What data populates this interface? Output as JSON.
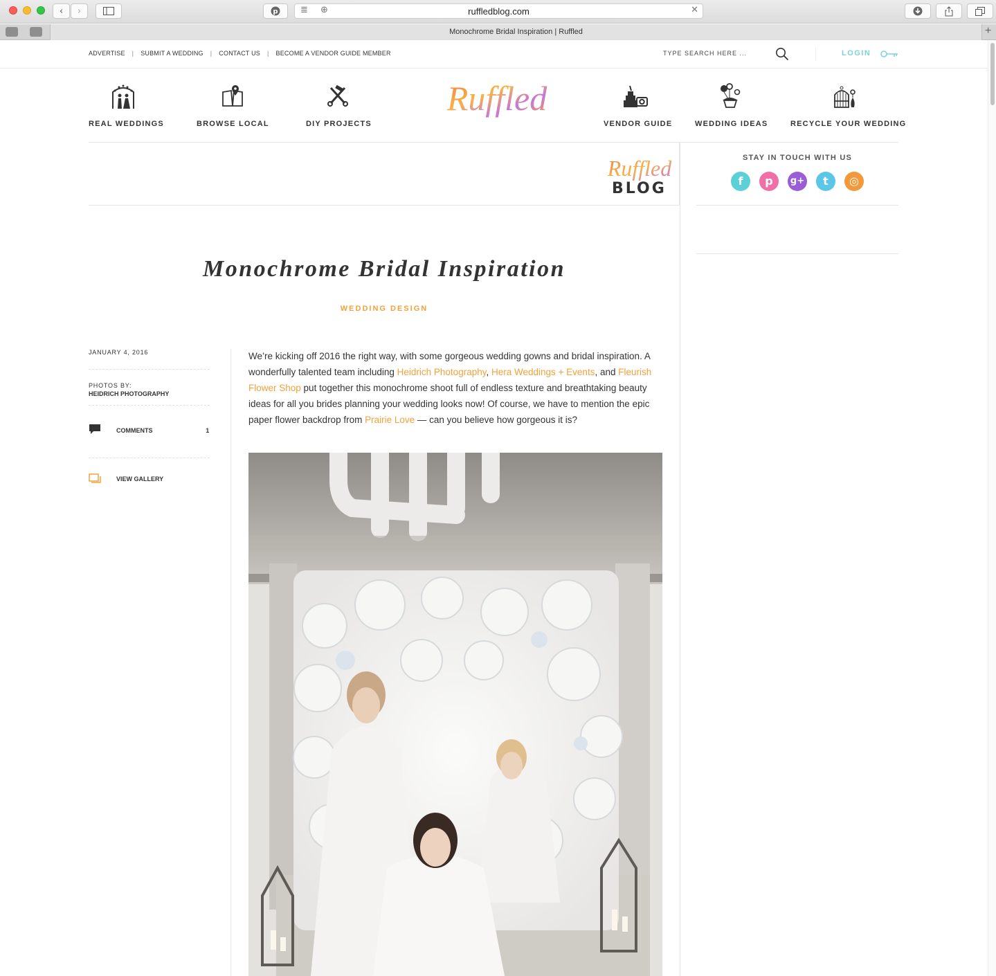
{
  "browser": {
    "url": "ruffledblog.com",
    "tab_title": "Monochrome Bridal Inspiration | Ruffled",
    "back_icon": "chevron-left-icon",
    "forward_icon": "chevron-right-icon",
    "sidebar_icon": "sidebar-icon",
    "pinterest_icon": "pinterest-icon",
    "reader_icon": "reader-icon",
    "add_icon": "plus-icon",
    "close_icon": "close-icon",
    "download_icon": "download-icon",
    "share_icon": "share-icon",
    "tabs_icon": "tabs-icon"
  },
  "utility": {
    "links": [
      "ADVERTISE",
      "SUBMIT A WEDDING",
      "CONTACT US",
      "BECOME A VENDOR GUIDE MEMBER"
    ],
    "separator": "|",
    "search_placeholder": "TYPE SEARCH HERE ...",
    "login": "LOGIN",
    "accent": "#7fd3d6"
  },
  "nav": {
    "left": [
      {
        "label": "REAL WEDDINGS",
        "icon": "couple-arch-icon"
      },
      {
        "label": "BROWSE LOCAL",
        "icon": "map-pin-book-icon"
      },
      {
        "label": "DIY PROJECTS",
        "icon": "tools-icon"
      }
    ],
    "right": [
      {
        "label": "VENDOR GUIDE",
        "icon": "cake-camera-icon"
      },
      {
        "label": "WEDDING IDEAS",
        "icon": "balloons-cupcake-icon"
      },
      {
        "label": "RECYCLE YOUR WEDDING",
        "icon": "birdcage-vase-icon"
      }
    ],
    "logo": "Ruffled"
  },
  "blog_header": {
    "logo_script": "Ruffled",
    "logo_word": "BLOG"
  },
  "sidebar": {
    "stay_in_touch": "STAY IN TOUCH WITH US",
    "socials": [
      {
        "name": "facebook-icon",
        "glyph": "f",
        "color": "#5bd1d7"
      },
      {
        "name": "pinterest-icon",
        "glyph": "p",
        "color": "#ef6fa8"
      },
      {
        "name": "google-plus-icon",
        "glyph": "g+",
        "color": "#9a5dd6"
      },
      {
        "name": "twitter-icon",
        "glyph": "t",
        "color": "#5bc6e6"
      },
      {
        "name": "instagram-icon",
        "glyph": "◎",
        "color": "#f3993b"
      }
    ]
  },
  "post": {
    "title": "Monochrome Bridal Inspiration",
    "category": "WEDDING DESIGN",
    "date": "JANUARY 4, 2016",
    "photos_by_label": "PHOTOS BY:",
    "photographer": "HEIDRICH PHOTOGRAPHY",
    "comments_label": "COMMENTS",
    "comments_count": "1",
    "view_gallery": "VIEW GALLERY",
    "body": {
      "t1": "We’re kicking off 2016 the right way, with some gorgeous wedding gowns and bridal inspiration. A wonderfully talented team including ",
      "link1": "Heidrich Photography",
      "t2": ", ",
      "link2": "Hera Weddings + Events",
      "t3": ", and ",
      "link3": "Fleurish Flower Shop",
      "t4": " put together this monochrome shoot full of endless texture and breathtaking beauty ideas for all you brides planning your wedding looks now! Of course, we have to mention the epic paper flower backdrop from ",
      "link4": "Prairie Love",
      "t5": " — can you believe how gorgeous it is?"
    },
    "link_color": "#f3a13b",
    "image_alt": "Three brides in white gowns posing in front of a white paper flower backdrop"
  }
}
